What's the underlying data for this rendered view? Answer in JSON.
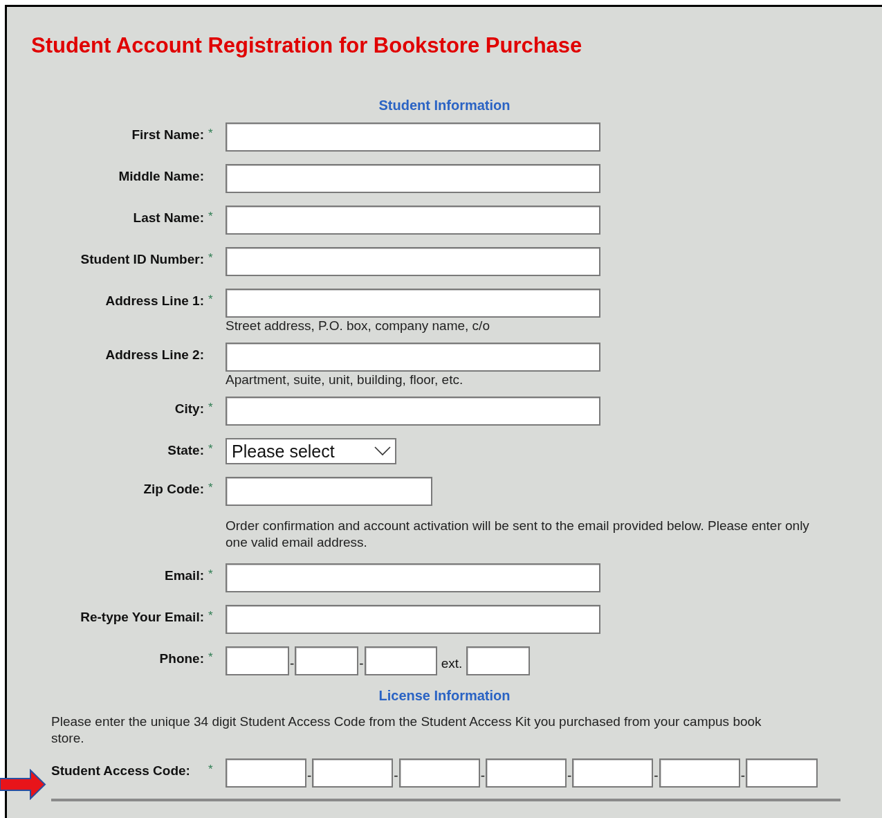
{
  "title": "Student Account Registration for Bookstore Purchase",
  "required_mark": "*",
  "student_section": {
    "heading": "Student Information",
    "fields": [
      {
        "kind": "text",
        "label": "First Name:",
        "required": true
      },
      {
        "kind": "text",
        "label": "Middle Name:",
        "required": false
      },
      {
        "kind": "text",
        "label": "Last Name:",
        "required": true
      },
      {
        "kind": "text",
        "label": "Student ID Number:",
        "required": true
      },
      {
        "kind": "text",
        "label": "Address Line 1:",
        "required": true,
        "hint": "Street address, P.O. box, company name, c/o"
      },
      {
        "kind": "text",
        "label": "Address Line 2:",
        "required": false,
        "hint": "Apartment, suite, unit, building, floor, etc."
      },
      {
        "kind": "text",
        "label": "City:",
        "required": true
      },
      {
        "kind": "select",
        "label": "State:",
        "required": true,
        "value": "Please select"
      },
      {
        "kind": "short",
        "label": "Zip Code:",
        "required": true
      },
      {
        "kind": "note",
        "text": "Order confirmation and account activation will be sent to the email provided below. Please enter only one valid email address."
      },
      {
        "kind": "text",
        "label": "Email:",
        "required": true
      },
      {
        "kind": "text",
        "label": "Re-type Your Email:",
        "required": true
      },
      {
        "kind": "phone",
        "label": "Phone:",
        "required": true,
        "separators": [
          "-",
          "-",
          "ext."
        ]
      }
    ]
  },
  "license_section": {
    "heading": "License Information",
    "instructions": "Please enter the unique 34 digit Student Access Code from the Student Access Kit you purchased from your campus book store.",
    "access_code": {
      "label": "Student Access Code:",
      "required": true,
      "separators": [
        "-",
        "-",
        "-",
        "-",
        "-",
        "-"
      ]
    }
  }
}
